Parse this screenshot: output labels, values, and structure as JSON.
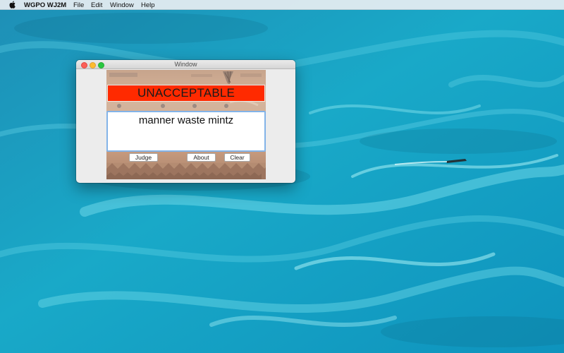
{
  "menubar": {
    "app_name": "WGPO WJ2M",
    "items": [
      "File",
      "Edit",
      "Window",
      "Help"
    ]
  },
  "window": {
    "title": "Window"
  },
  "verdict": {
    "text": "UNACCEPTABLE",
    "color": "#ff2a00"
  },
  "phrase": {
    "value": "manner waste mintz"
  },
  "buttons": {
    "judge": "Judge",
    "about": "About",
    "clear": "Clear"
  }
}
